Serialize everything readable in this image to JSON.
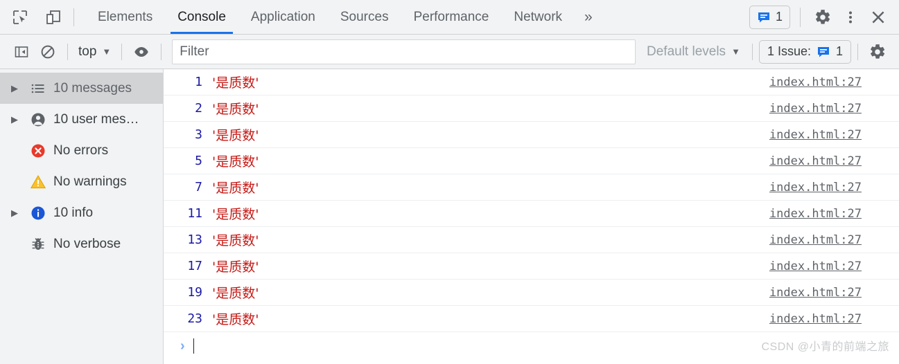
{
  "devtools": {
    "toolbar": {
      "inspect_icon": "inspect-element-icon",
      "device_icon": "device-toolbar-icon",
      "tabs": [
        {
          "label": "Elements",
          "active": false
        },
        {
          "label": "Console",
          "active": true
        },
        {
          "label": "Application",
          "active": false
        },
        {
          "label": "Sources",
          "active": false
        },
        {
          "label": "Performance",
          "active": false
        },
        {
          "label": "Network",
          "active": false
        }
      ],
      "more_tabs_glyph": "»",
      "issues_badge": {
        "icon": "issue-message-icon",
        "count": "1"
      },
      "settings_icon": "gear-icon",
      "more_options_icon": "kebab-menu-icon",
      "close_icon": "close-icon",
      "active_tab_underline_color": "#1a73e8"
    },
    "filterbar": {
      "sidebar_toggle_icon": "sidebar-toggle-icon",
      "clear_console_icon": "clear-console-icon",
      "context_selector": {
        "value": "top",
        "caret": "▼"
      },
      "eye_icon": "live-expression-eye-icon",
      "filter": {
        "placeholder": "Filter",
        "value": ""
      },
      "levels_selector": {
        "value": "Default levels",
        "caret": "▼"
      },
      "issues_button": {
        "label": "1 Issue:",
        "icon": "issue-message-icon",
        "count": "1"
      },
      "settings_icon": "gear-icon"
    },
    "sidebar": {
      "items": [
        {
          "label": "10 messages",
          "icon": "list-icon",
          "arrow": true,
          "selected": true
        },
        {
          "label": "10 user mes…",
          "icon": "user-icon",
          "arrow": true,
          "selected": false
        },
        {
          "label": "No errors",
          "icon": "error-icon",
          "arrow": false,
          "selected": false
        },
        {
          "label": "No warnings",
          "icon": "warning-icon",
          "arrow": false,
          "selected": false
        },
        {
          "label": "10 info",
          "icon": "info-icon",
          "arrow": true,
          "selected": false
        },
        {
          "label": "No verbose",
          "icon": "bug-icon",
          "arrow": false,
          "selected": false
        }
      ],
      "arrow_glyph": "▶"
    },
    "console": {
      "number_color": "#1a1aa6",
      "string_color": "#c41a16",
      "rows": [
        {
          "num": "1",
          "message": "'是质数'",
          "source": "index.html:27"
        },
        {
          "num": "2",
          "message": "'是质数'",
          "source": "index.html:27"
        },
        {
          "num": "3",
          "message": "'是质数'",
          "source": "index.html:27"
        },
        {
          "num": "5",
          "message": "'是质数'",
          "source": "index.html:27"
        },
        {
          "num": "7",
          "message": "'是质数'",
          "source": "index.html:27"
        },
        {
          "num": "11",
          "message": "'是质数'",
          "source": "index.html:27"
        },
        {
          "num": "13",
          "message": "'是质数'",
          "source": "index.html:27"
        },
        {
          "num": "17",
          "message": "'是质数'",
          "source": "index.html:27"
        },
        {
          "num": "19",
          "message": "'是质数'",
          "source": "index.html:27"
        },
        {
          "num": "23",
          "message": "'是质数'",
          "source": "index.html:27"
        }
      ],
      "prompt": {
        "chevron": "›",
        "value": ""
      }
    },
    "watermark": "CSDN @小青的前端之旅"
  }
}
